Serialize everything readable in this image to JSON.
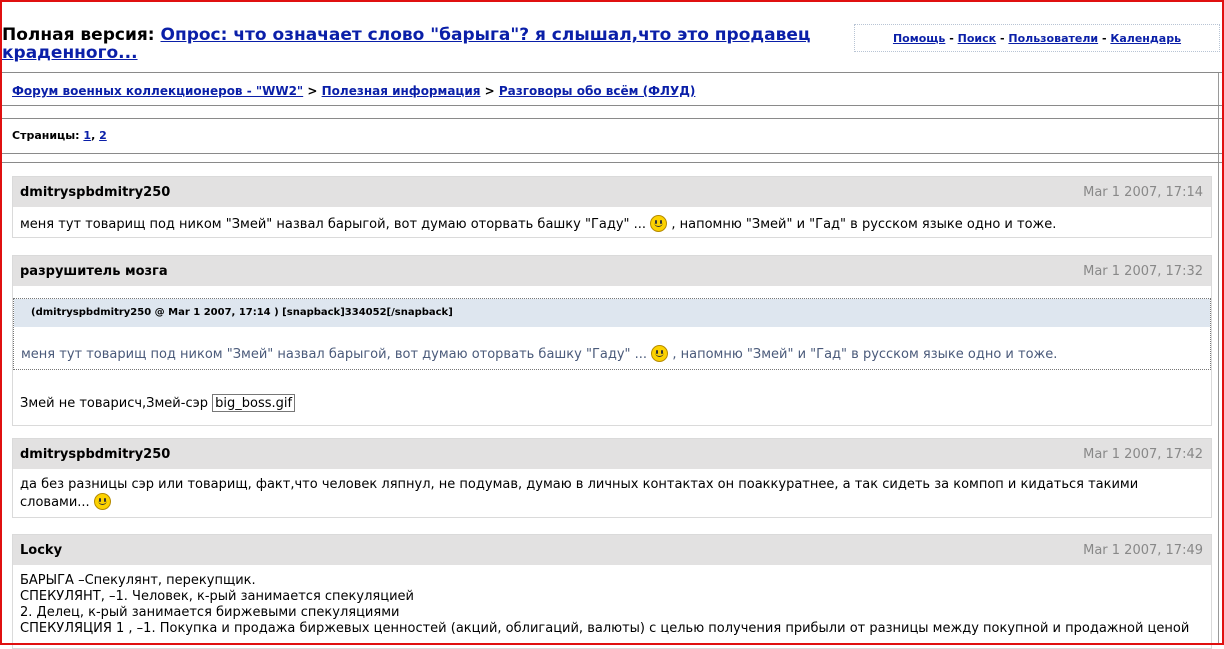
{
  "header": {
    "prefix": "Полная версия:",
    "topic_title": "Опрос: что означает слово \"барыга\"? я слышал,что это продавец краденного...",
    "links": [
      "Помощь",
      "Поиск",
      "Пользователи",
      "Календарь"
    ],
    "separator": "-"
  },
  "breadcrumb": {
    "items": [
      "Форум военных коллекционеров - \"WW2\"",
      "Полезная информация",
      "Разговоры обо всём (ФЛУД)"
    ],
    "separator": ">"
  },
  "pagination": {
    "label": "Страницы:",
    "pages": [
      "1",
      "2"
    ],
    "separator": ","
  },
  "posts": [
    {
      "author": "dmitryspbdmitry250",
      "date": "Mar 1 2007, 17:14",
      "text_a": "меня тут товарищ под ником \"Змей\" назвал барыгой, вот думаю оторвать башку \"Гаду\" ...",
      "text_b": ", напомню \"Змей\" и \"Гад\" в русском языке одно и тоже."
    },
    {
      "author": "разрушитель мозга",
      "date": "Mar 1 2007, 17:32",
      "quote_header": "(dmitryspbdmitry250 @ Mar 1 2007, 17:14 ) [snapback]334052[/snapback]",
      "quote_a": "меня тут товарищ под ником \"Змей\" назвал барыгой, вот думаю оторвать башку \"Гаду\" ...",
      "quote_b": ", напомню \"Змей\" и \"Гад\" в русском языке одно и тоже.",
      "text": "Змей не товарисч,Змей-сэр",
      "image_name": "big_boss.gif"
    },
    {
      "author": "dmitryspbdmitry250",
      "date": "Mar 1 2007, 17:42",
      "text": "да без разницы сэр или товарищ, факт,что человек ляпнул, не подумав, думаю в личных контактах он поаккуратнее, а так сидеть за компоп и кидаться такими словами..."
    },
    {
      "author": "Locky",
      "date": "Mar 1 2007, 17:49",
      "lines": [
        "БАРЫГА –Спекулянт, перекупщик.",
        "СПЕКУЛЯНТ, –1. Человек, к-рый занимается спекуляцией",
        "2. Делец, к-рый занимается биржевыми спекуляциями",
        "СПЕКУЛЯЦИЯ 1 , –1. Покупка и продажа биржевых ценностей (акций, облигаций, валюты) с целью получения прибыли от разницы между покупной и продажной ценой"
      ]
    }
  ]
}
